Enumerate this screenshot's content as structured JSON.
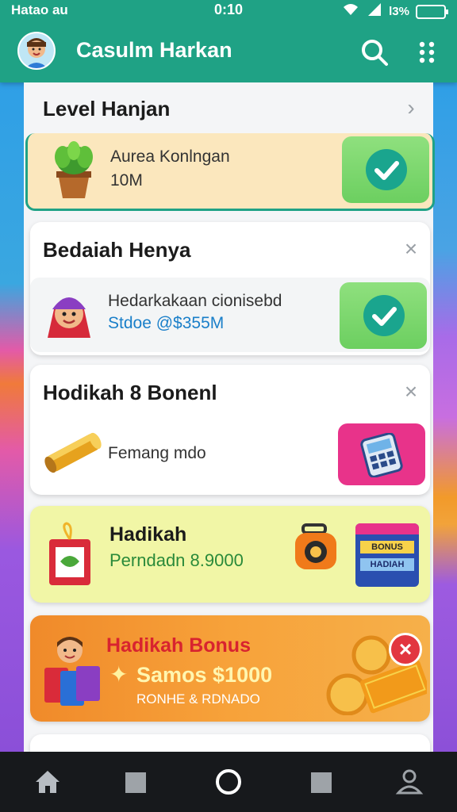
{
  "status_bar": {
    "carrier": "Hatao au",
    "time": "0:10",
    "battery_text": "l3%"
  },
  "app_bar": {
    "title": "Casulm Harkan",
    "color": "#1fa285"
  },
  "cards": [
    {
      "title": "Level Hanjan",
      "item_line1": "Aurea Konlngan",
      "item_line2": "10M",
      "icon": "plant-pot-icon",
      "action_icon": "check-icon"
    },
    {
      "title": "Bedaiah Henya",
      "item_line1": "Hedarkakaan cionisebd",
      "item_line2": "Stdoe @$355M",
      "icon": "character-avatar-icon",
      "action_icon": "check-icon"
    },
    {
      "title": "Hodikah 8 Bonenl",
      "item_line1": "Femang mdo",
      "icon": "gold-pipe-icon",
      "action_icon": "calculator-icon"
    }
  ],
  "promo_yellow": {
    "title": "Hadikah",
    "subtitle": "Perndadn 8.9000",
    "badge_line1": "BONUS",
    "badge_line2": "HADIAH"
  },
  "promo_orange": {
    "title": "Hadikah Bonus",
    "amount": "Samos $1000",
    "caption": "RONHE & RDNADO"
  },
  "nav": [
    "home-icon",
    "square-icon",
    "circle-icon",
    "square-icon",
    "profile-icon"
  ]
}
